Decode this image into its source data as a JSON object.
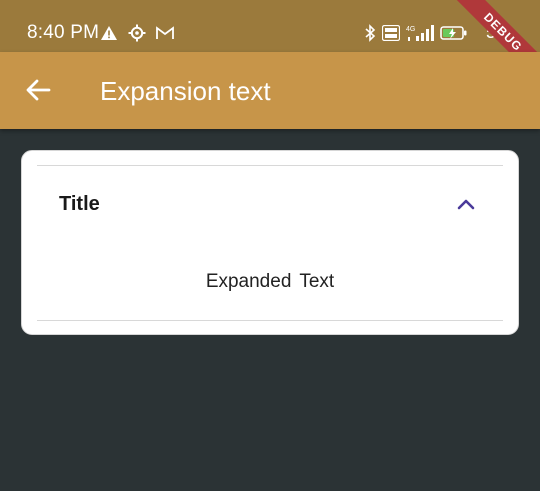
{
  "status_bar": {
    "time": "8:40 PM",
    "left_icons": [
      "warning-icon",
      "settings-icon",
      "gmail-icon"
    ],
    "right_icons": [
      "bluetooth-icon",
      "volte-icon",
      "signal-4g-icon",
      "battery-charging-icon"
    ],
    "battery_text": "54"
  },
  "debug_banner": {
    "label": "DEBUG",
    "color": "#b0383a"
  },
  "app_bar": {
    "title": "Expansion text",
    "back_icon": "arrow-back-icon",
    "color": "#c79549"
  },
  "expansion_tile": {
    "title": "Title",
    "expanded": true,
    "icon": "chevron-up-icon",
    "icon_color": "#4a3a9a",
    "content": "Expanded  Text"
  }
}
